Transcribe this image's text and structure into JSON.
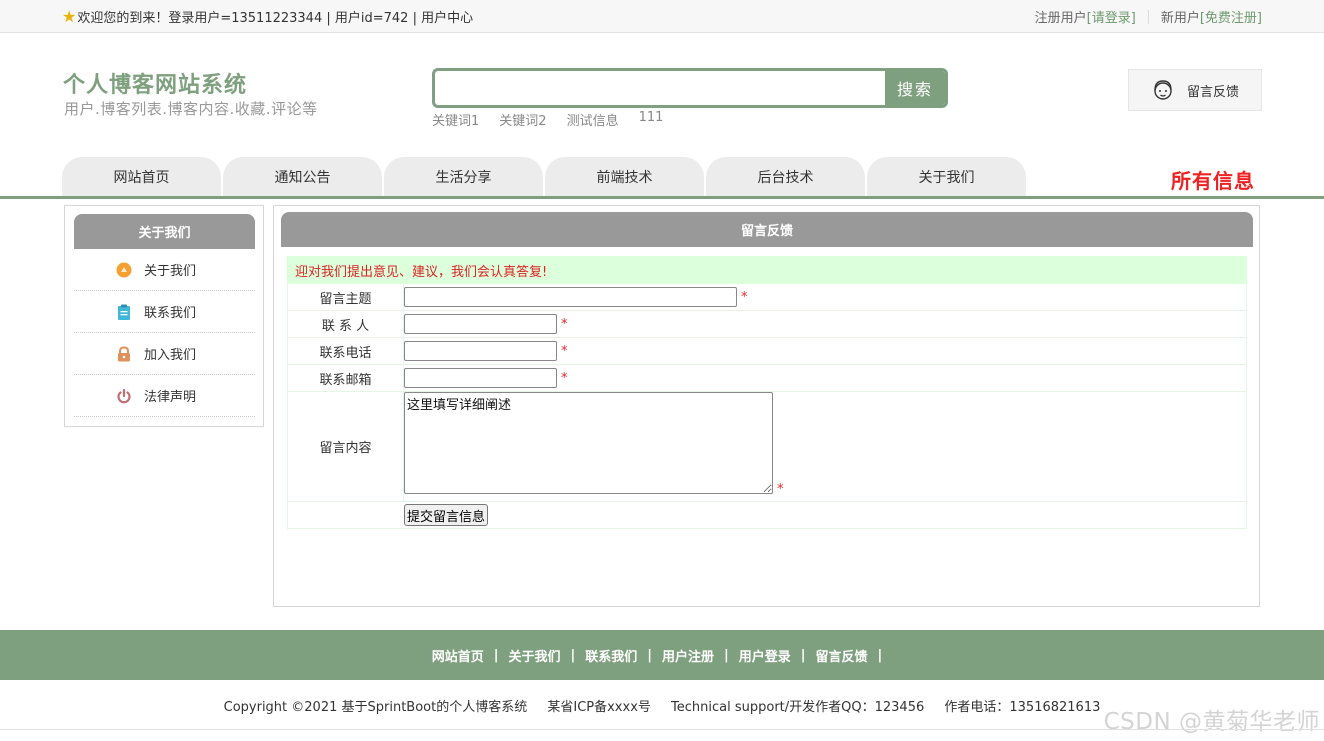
{
  "topbar": {
    "welcome": "欢迎您的到来！登录用户=13511223344 | 用户id=742 | 用户中心",
    "register_user_label": "注册用户",
    "login_link": "[请登录]",
    "new_user_label": "新用户",
    "free_register_link": "[免费注册]"
  },
  "brand": {
    "title": "个人博客网站系统",
    "subtitle": "用户.博客列表.博客内容.收藏.评论等"
  },
  "search": {
    "value": "",
    "button": "搜索",
    "hot_keywords": [
      "关键词1",
      "关键词2",
      "测试信息",
      "111"
    ]
  },
  "header_feedback": "留言反馈",
  "nav": {
    "items": [
      "网站首页",
      "通知公告",
      "生活分享",
      "前端技术",
      "后台技术",
      "关于我们"
    ],
    "all_info": "所有信息"
  },
  "side": {
    "title": "关于我们",
    "items": [
      {
        "label": "关于我们",
        "icon": "about-icon",
        "color": "#f5a030"
      },
      {
        "label": "联系我们",
        "icon": "clipboard-icon",
        "color": "#40b8d8"
      },
      {
        "label": "加入我们",
        "icon": "lock-icon",
        "color": "#e0905a"
      },
      {
        "label": "法律声明",
        "icon": "power-icon",
        "color": "#c07070"
      }
    ]
  },
  "main": {
    "title": "留言反馈",
    "notice": "迎对我们提出意见、建议，我们会认真答复!",
    "form": {
      "subject_label": "留言主题",
      "contact_label": "联 系 人",
      "phone_label": "联系电话",
      "email_label": "联系邮箱",
      "content_label": "留言内容",
      "content_value": "这里填写详细阐述",
      "required_mark": "*",
      "submit": "提交留言信息"
    }
  },
  "footer": {
    "links": [
      "网站首页",
      "关于我们",
      "联系我们",
      "用户注册",
      "用户登录",
      "留言反馈"
    ],
    "separator": "|",
    "copyright": "Copyright ©2021 基于SprintBoot的个人博客系统",
    "icp": "某省ICP备xxxx号",
    "support": "Technical support/开发作者QQ：123456",
    "phone": "作者电话：13516821613"
  },
  "watermark": "CSDN @黄菊华老师",
  "colors": {
    "accent": "#7ea07e",
    "danger": "#ee2222",
    "notice_bg": "#dcffdc"
  }
}
